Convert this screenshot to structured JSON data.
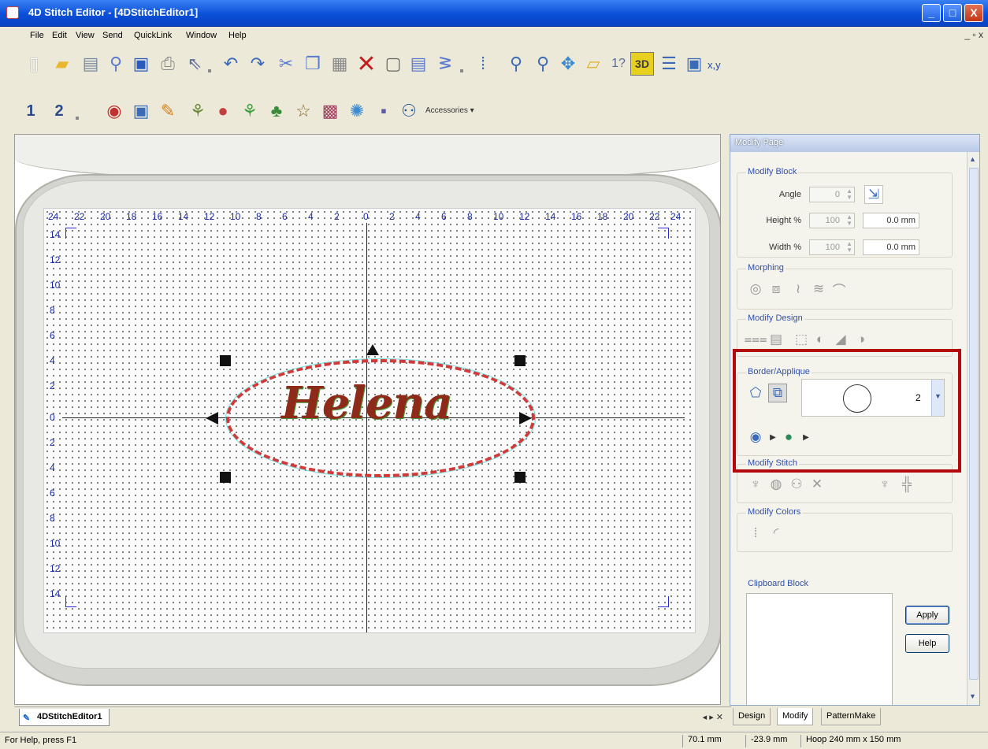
{
  "window": {
    "title": "4D Stitch Editor - [4DStitchEditor1]",
    "buttons": {
      "minimize": "_",
      "maximize": "□",
      "close": "X"
    }
  },
  "menu": {
    "items": [
      "File",
      "Edit",
      "View",
      "Send",
      "QuickLink",
      "Window",
      "Help"
    ],
    "mdi_controls": "_ ▫ x"
  },
  "toolbar2": {
    "label1": "1",
    "label2": "2",
    "accessories": "Accessories ▾"
  },
  "toolbar1": {
    "xy_label": "x,y"
  },
  "canvas": {
    "ruler_top": [
      "24",
      "22",
      "20",
      "18",
      "16",
      "14",
      "12",
      "10",
      "8",
      "6",
      "4",
      "2",
      "0",
      "2",
      "4",
      "6",
      "8",
      "10",
      "12",
      "14",
      "16",
      "18",
      "20",
      "22",
      "24"
    ],
    "ruler_left": [
      "14",
      "12",
      "10",
      "8",
      "6",
      "4",
      "2",
      "0",
      "2",
      "4",
      "6",
      "8",
      "10",
      "12",
      "14"
    ],
    "design_text": "Helena"
  },
  "doc_tab": {
    "label": "4DStitchEditor1",
    "nav": "◂ ▸ ✕"
  },
  "status": {
    "help": "For Help, press F1",
    "x": "70.1 mm",
    "y": "-23.9 mm",
    "hoop": "Hoop  240 mm x 150 mm"
  },
  "panel": {
    "title": "Modify Page",
    "modify_block": {
      "label": "Modify Block",
      "angle_label": "Angle",
      "angle_value": "0",
      "height_label": "Height %",
      "height_value": "100",
      "height_mm": "0.0 mm",
      "width_label": "Width %",
      "width_value": "100",
      "width_mm": "0.0 mm"
    },
    "morphing": {
      "label": "Morphing"
    },
    "modify_design": {
      "label": "Modify Design"
    },
    "border_applique": {
      "label": "Border/Applique",
      "shape_number": "2"
    },
    "modify_stitch": {
      "label": "Modify Stitch"
    },
    "modify_colors": {
      "label": "Modify Colors"
    },
    "clipboard_block": {
      "label": "Clipboard Block"
    },
    "apply_button": "Apply",
    "help_button": "Help"
  },
  "mode_tabs": [
    "Design",
    "Modify",
    "PatternMake"
  ],
  "colors": {
    "title_bar": "#0a4fd8",
    "highlight": "#b3090c",
    "design_red": "#8e2a1a",
    "border_dash": "#d23a3a",
    "ruler_text": "#1a2aa0"
  }
}
